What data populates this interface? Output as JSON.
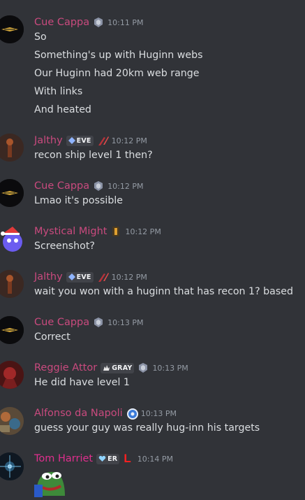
{
  "colors": {
    "background": "#313338",
    "cue": "#c94a7e",
    "jalthy": "#c94a7e",
    "mystical": "#c94a7e",
    "reggie": "#c94a7e",
    "alfonso": "#c94a7e",
    "tom": "#e02f8e",
    "text": "#dbdee1",
    "timestamp": "#949ba4"
  },
  "messages": [
    {
      "user": "Cue Cappa",
      "time": "10:11 PM",
      "lines": [
        "So",
        "Something's up with Huginn webs",
        "Our Huginn had 20km web range",
        "With links",
        "And heated"
      ]
    },
    {
      "user": "Jalthy",
      "tag": "EVE",
      "time": "10:12 PM",
      "lines": [
        "recon ship level 1 then?"
      ]
    },
    {
      "user": "Cue Cappa",
      "time": "10:12 PM",
      "lines": [
        "Lmao it's possible"
      ]
    },
    {
      "user": "Mystical Might",
      "time": "10:12 PM",
      "lines": [
        "Screenshot?"
      ]
    },
    {
      "user": "Jalthy",
      "tag": "EVE",
      "time": "10:12 PM",
      "lines": [
        "wait you won with a huginn that has recon 1? based"
      ]
    },
    {
      "user": "Cue Cappa",
      "time": "10:13 PM",
      "lines": [
        "Correct"
      ]
    },
    {
      "user": "Reggie Attor",
      "tag": "GRAY",
      "time": "10:13 PM",
      "lines": [
        "He did have level 1"
      ]
    },
    {
      "user": "Alfonso da Napoli",
      "time": "10:13 PM",
      "lines": [
        "guess your guy was really hug-inn his targets"
      ]
    },
    {
      "user": "Tom Harriet",
      "tag": "ER",
      "role_letter": "L",
      "time": "10:14 PM",
      "lines": []
    }
  ]
}
